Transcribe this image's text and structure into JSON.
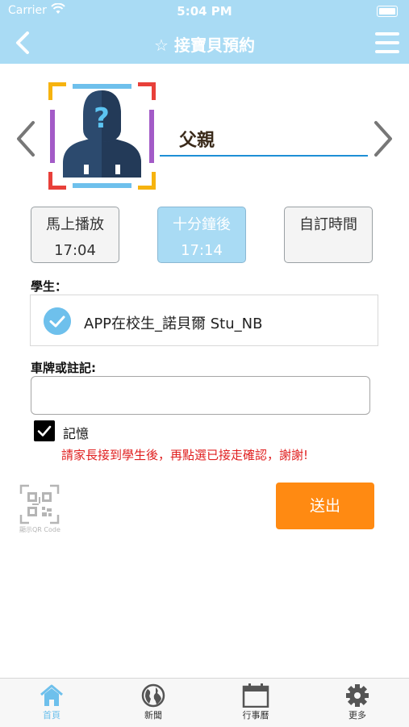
{
  "status_bar": {
    "carrier": "Carrier",
    "time": "5:04 PM"
  },
  "nav": {
    "title": "☆ 接寶貝預約",
    "back_icon": "chevron-left-icon",
    "menu_icon": "hamburger-menu-icon"
  },
  "pickup_person": {
    "name": "父親"
  },
  "time_options": [
    {
      "label": "馬上播放",
      "time": "17:04",
      "selected": false
    },
    {
      "label": "十分鐘後",
      "time": "17:14",
      "selected": true
    },
    {
      "label": "自訂時間",
      "time": "",
      "selected": false
    }
  ],
  "student": {
    "label": "學生：",
    "name": "APP在校生_諾貝爾 Stu_NB",
    "checked": true
  },
  "plate": {
    "label": "車牌或註記:",
    "value": ""
  },
  "remember": {
    "label": "記憶",
    "checked": true
  },
  "notice": "請家長接到學生後，再點選已接走確認，謝謝!",
  "qr": {
    "label": "顯示QR Code"
  },
  "submit_label": "送出",
  "tabs": [
    {
      "label": "首頁",
      "icon": "home-icon",
      "active": true
    },
    {
      "label": "新聞",
      "icon": "globe-icon",
      "active": false
    },
    {
      "label": "行事曆",
      "icon": "calendar-icon",
      "active": false
    },
    {
      "label": "更多",
      "icon": "gear-icon",
      "active": false
    }
  ],
  "colors": {
    "header": "#a9dbf4",
    "accent": "#6ec0ec",
    "submit": "#ff8a12",
    "notice": "#e02020"
  }
}
